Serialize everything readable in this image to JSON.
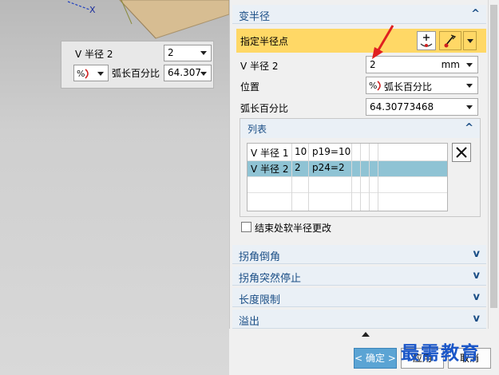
{
  "viewport": {
    "axis_label": "X",
    "popup": {
      "radius_label": "V 半径 2",
      "radius_value": "2",
      "mode_icon": "percent-arc-icon",
      "mode_label": "弧长百分比",
      "mode_value": "64.307"
    }
  },
  "panel": {
    "section_main": {
      "title": "变半径"
    },
    "specify_point": {
      "label": "指定半径点"
    },
    "radius": {
      "label": "V 半径 2",
      "value": "2",
      "unit": "mm"
    },
    "position": {
      "label": "位置",
      "value": "弧长百分比"
    },
    "arc_percent": {
      "label": "弧长百分比",
      "value": "64.30773468"
    },
    "list": {
      "title": "列表",
      "rows": [
        {
          "name": "V 半径 1",
          "radius": "10",
          "expr": "p19=10"
        },
        {
          "name": "V 半径 2",
          "radius": "2",
          "expr": "p24=2"
        }
      ]
    },
    "soft_change": {
      "label": "结束处软半径更改",
      "checked": false
    },
    "collapsed_sections": [
      "拐角倒角",
      "拐角突然停止",
      "长度限制",
      "溢出"
    ],
    "buttons": {
      "ok": "< 确定 >",
      "apply": "应用",
      "cancel": "取消"
    }
  },
  "watermark": "最需教育",
  "colors": {
    "accent": "#1a4e86",
    "highlight": "#ffd866",
    "selection": "#8fc3d4",
    "primary_button": "#5ba4d4",
    "annotation_arrow": "#e02020"
  }
}
